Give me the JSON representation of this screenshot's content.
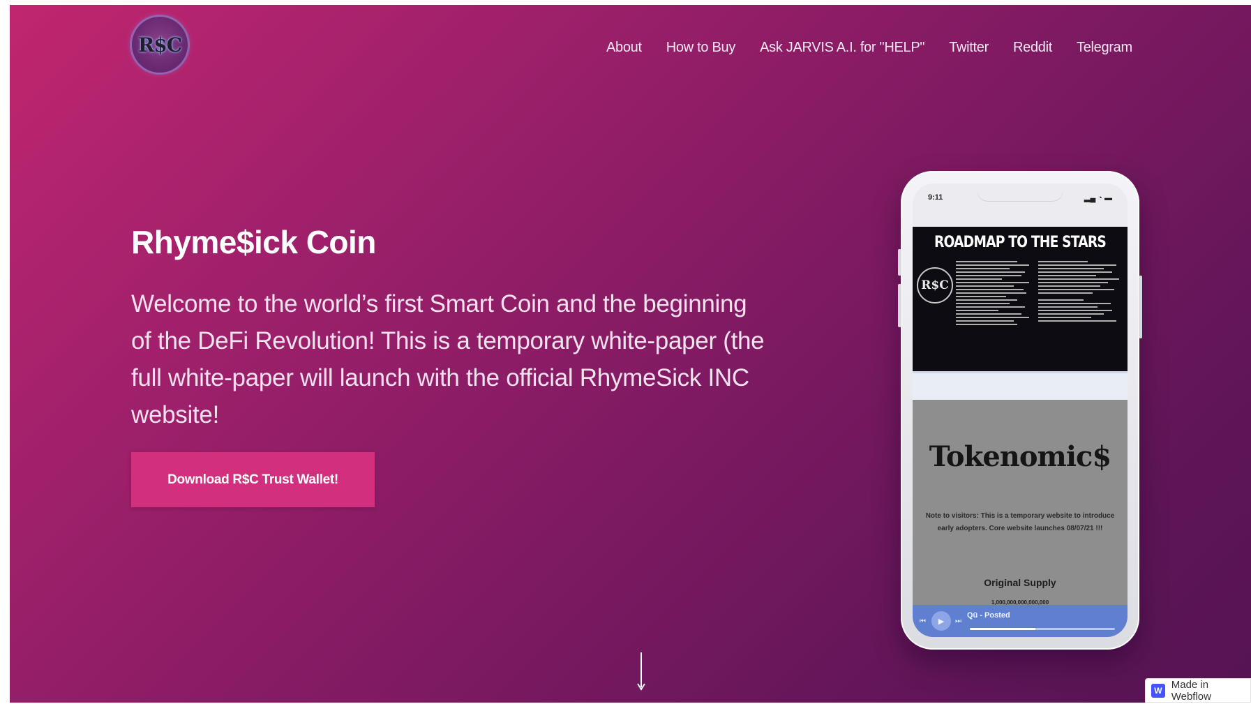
{
  "logo": {
    "text": "R$C"
  },
  "nav": [
    {
      "label": "About"
    },
    {
      "label": "How to Buy"
    },
    {
      "label": "Ask JARVIS A.I. for \"HELP\""
    },
    {
      "label": "Twitter"
    },
    {
      "label": "Reddit"
    },
    {
      "label": "Telegram"
    }
  ],
  "hero": {
    "title": "Rhyme$ick Coin",
    "body": "Welcome to the world’s first Smart Coin and the beginning of the DeFi Revolution! This is a temporary white-paper (the full white-paper will launch with the official RhymeSick INC website!",
    "cta_label": "Download R$C Trust Wallet!"
  },
  "phone": {
    "status_time": "9:11",
    "roadmap_title": "ROADMAP TO THE STARS",
    "roadmap_logo": "R$C",
    "tokenomics_title": "Tokenomic$",
    "note": "Note to visitors: This is a temporary website to introduce early adopters. Core website launches 08/07/21 !!!",
    "supply_label": "Original Supply",
    "supply_value": "1,000,000,000,000,000",
    "player_track": "Qū - Posted",
    "player_progress": 0.45
  },
  "badge": {
    "label": "Made in Webflow",
    "logo": "W"
  },
  "colors": {
    "accent": "#d2307e",
    "bg_start": "#c0266f",
    "bg_end": "#561453",
    "player": "#5f7fd1"
  },
  "icons": [
    "logo-icon",
    "down-arrow-icon",
    "webflow-logo-icon",
    "play-icon",
    "prev-icon",
    "next-icon"
  ]
}
